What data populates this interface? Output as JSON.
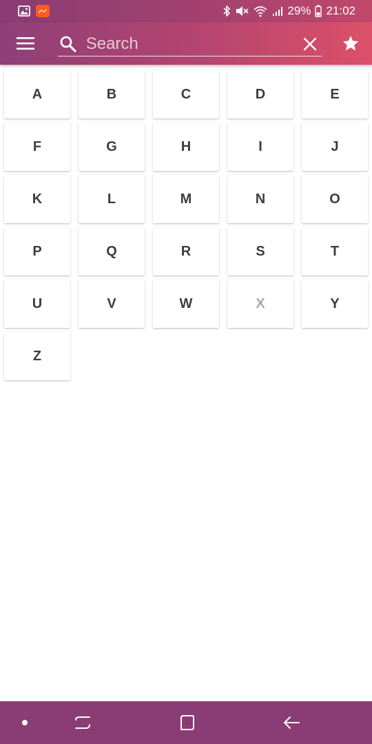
{
  "status_bar": {
    "battery": "29%",
    "time": "21:02",
    "icons": [
      "gallery-icon",
      "app-notification-icon",
      "bluetooth-icon",
      "mute-icon",
      "wifi-icon",
      "signal-icon",
      "battery-icon"
    ]
  },
  "app_bar": {
    "menu_icon": "hamburger-menu-icon",
    "search": {
      "placeholder": "Search",
      "value": "",
      "icon": "search-icon",
      "clear_icon": "close-icon"
    },
    "favorites_icon": "star-icon"
  },
  "letters": [
    {
      "label": "A",
      "enabled": true
    },
    {
      "label": "B",
      "enabled": true
    },
    {
      "label": "C",
      "enabled": true
    },
    {
      "label": "D",
      "enabled": true
    },
    {
      "label": "E",
      "enabled": true
    },
    {
      "label": "F",
      "enabled": true
    },
    {
      "label": "G",
      "enabled": true
    },
    {
      "label": "H",
      "enabled": true
    },
    {
      "label": "I",
      "enabled": true
    },
    {
      "label": "J",
      "enabled": true
    },
    {
      "label": "K",
      "enabled": true
    },
    {
      "label": "L",
      "enabled": true
    },
    {
      "label": "M",
      "enabled": true
    },
    {
      "label": "N",
      "enabled": true
    },
    {
      "label": "O",
      "enabled": true
    },
    {
      "label": "P",
      "enabled": true
    },
    {
      "label": "Q",
      "enabled": true
    },
    {
      "label": "R",
      "enabled": true
    },
    {
      "label": "S",
      "enabled": true
    },
    {
      "label": "T",
      "enabled": true
    },
    {
      "label": "U",
      "enabled": true
    },
    {
      "label": "V",
      "enabled": true
    },
    {
      "label": "W",
      "enabled": true
    },
    {
      "label": "X",
      "enabled": false
    },
    {
      "label": "Y",
      "enabled": true
    },
    {
      "label": "Z",
      "enabled": true
    }
  ],
  "nav_bar": {
    "icons": [
      "dot-icon",
      "recent-apps-icon",
      "home-icon",
      "back-icon"
    ]
  },
  "colors": {
    "primary_start": "#8e3f78",
    "primary_end": "#dc5069",
    "letter_text": "#3d3d3d",
    "letter_disabled": "#a9a9a9"
  }
}
